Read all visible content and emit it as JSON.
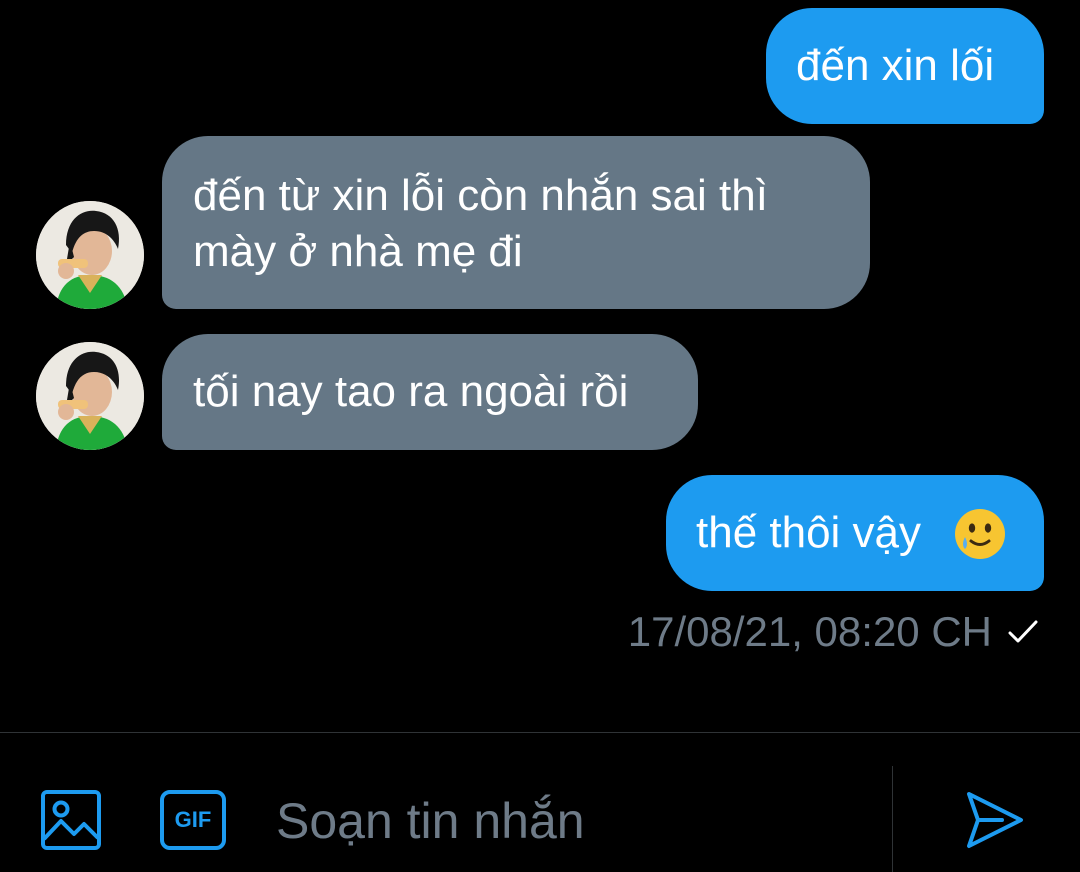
{
  "conversation": {
    "messages": [
      {
        "direction": "outgoing",
        "text": "đến xin lối"
      },
      {
        "direction": "incoming",
        "lines": [
          "đến từ xin lỗi còn nhắn sai thì",
          "mày ở nhà mẹ đi"
        ]
      },
      {
        "direction": "incoming",
        "text": "tối nay tao ra ngoài rồi"
      },
      {
        "direction": "outgoing",
        "text": "thế thôi vậy",
        "emoji": "🥲"
      }
    ],
    "last_message_meta": {
      "timestamp": "17/08/21, 08:20 CH",
      "read_receipt_icon": "checkmark-icon"
    }
  },
  "composer": {
    "placeholder": "Soạn tin nhắn",
    "value": "",
    "media_icon": "image-icon",
    "gif_label": "GIF",
    "send_icon": "send-icon"
  },
  "colors": {
    "background": "#000000",
    "outgoing_bubble": "#1d9bf0",
    "incoming_bubble": "#657786",
    "muted_text": "#6e7b88",
    "accent": "#1d9bf0",
    "divider": "#2f3336"
  }
}
